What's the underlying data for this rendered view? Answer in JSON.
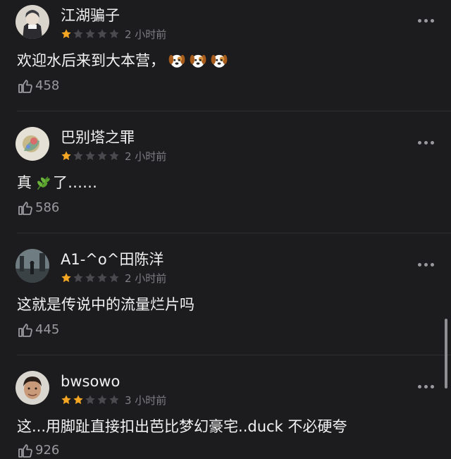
{
  "comments": [
    {
      "username": "江湖骗子",
      "rating": 1,
      "time": "2 小时前",
      "content": "欢迎水后来到大本营，",
      "emoji": [
        "dog-face-emoji",
        "dog-face-emoji",
        "dog-face-emoji"
      ],
      "likes": "458"
    },
    {
      "username": "巴别塔之罪",
      "rating": 1,
      "time": "2 小时前",
      "content_before": "真",
      "emoji": [
        "herb-emoji"
      ],
      "content_after": "了……",
      "likes": "586"
    },
    {
      "username": "A1-^o^田陈洋",
      "rating": 1,
      "time": "2 小时前",
      "content": "这就是传说中的流量烂片吗",
      "likes": "445"
    },
    {
      "username": "bwsowo",
      "rating": 2,
      "time": "3 小时前",
      "content": "这...用脚趾直接扣出芭比梦幻豪宅..duck 不必硬夸",
      "likes": "926"
    }
  ],
  "colors": {
    "background": "#1c1c1e",
    "star_filled": "#f5a623",
    "star_empty": "#4a4a4e",
    "secondary_text": "#7d7d82"
  },
  "icons": {
    "more": "more-dots-icon",
    "like": "thumbs-up-icon",
    "star": "star-icon"
  }
}
